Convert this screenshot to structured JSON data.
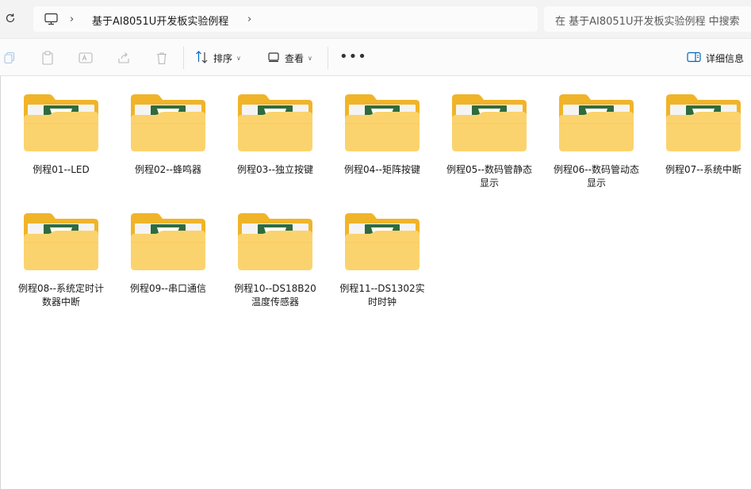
{
  "address_bar": {
    "breadcrumb": "基于AI8051U开发板实验例程",
    "search_placeholder": "在 基于AI8051U开发板实验例程 中搜索"
  },
  "command_bar": {
    "sort_label": "排序",
    "view_label": "查看",
    "more_label": "•••",
    "details_label": "详细信息"
  },
  "colors": {
    "folder_back": "#f0b429",
    "folder_front": "#fbd36e",
    "logo_green": "#2f6b3d",
    "accent_blue": "#0067c0"
  },
  "folders": [
    {
      "name": "例程01--LED"
    },
    {
      "name": "例程02--蜂鸣器"
    },
    {
      "name": "例程03--独立按键"
    },
    {
      "name": "例程04--矩阵按键"
    },
    {
      "name": "例程05--数码管静态显示"
    },
    {
      "name": "例程06--数码管动态显示"
    },
    {
      "name": "例程07--系统中断"
    },
    {
      "name": "例程08--系统定时计数器中断"
    },
    {
      "name": "例程09--串口通信"
    },
    {
      "name": "例程10--DS18B20温度传感器"
    },
    {
      "name": "例程11--DS1302实时时钟"
    }
  ]
}
